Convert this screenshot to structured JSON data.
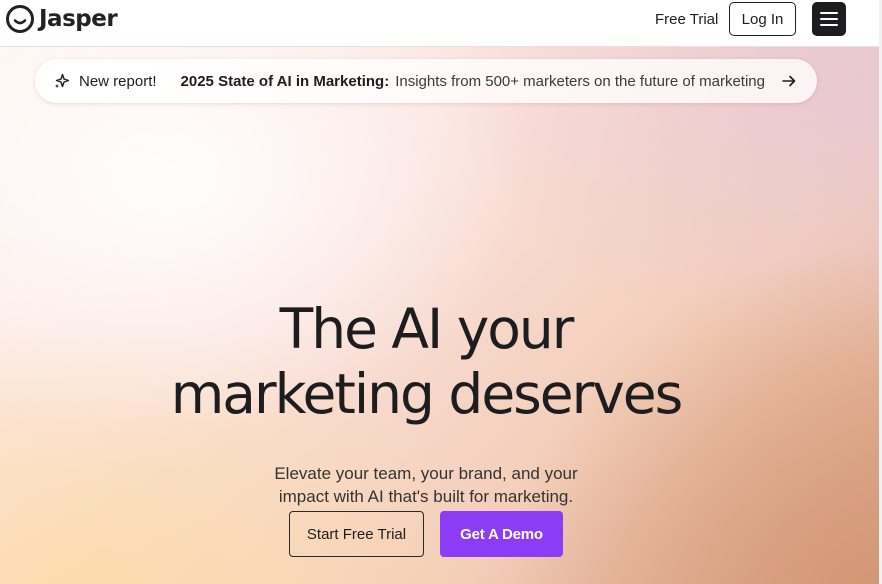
{
  "nav": {
    "brand": "Jasper",
    "free_trial_label": "Free Trial",
    "login_label": "Log In",
    "menu_icon": "hamburger-menu-icon"
  },
  "banner": {
    "pill_label": "New report!",
    "pill_icon": "sparkle-icon",
    "highlight": "2025 State of AI in Marketing:",
    "text": "Insights from 500+ marketers on the future of marketing",
    "arrow_icon": "arrow-right-icon"
  },
  "hero": {
    "headline_line1": "The AI your",
    "headline_line2": "marketing deserves",
    "subhead_line1": "Elevate your team, your brand, and your",
    "subhead_line2": "impact with AI that's built for marketing.",
    "primary_cta": "Start Free Trial",
    "secondary_cta": "Get A Demo"
  },
  "colors": {
    "accent": "#8c3cf5",
    "text": "#1d1d1f",
    "menu_button": "#1d1d1f"
  }
}
